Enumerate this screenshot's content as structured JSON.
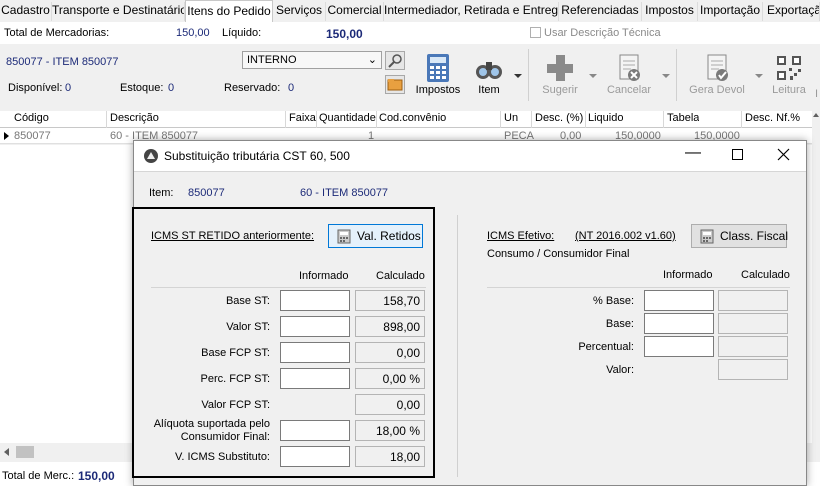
{
  "tabs": [
    {
      "label": "Cadastro"
    },
    {
      "label": "Transporte e Destinatário"
    },
    {
      "label": "Itens do Pedido"
    },
    {
      "label": "Serviços"
    },
    {
      "label": "Comercial"
    },
    {
      "label": "Intermediador, Retirada e Entrega"
    },
    {
      "label": "Referenciadas"
    },
    {
      "label": "Impostos"
    },
    {
      "label": "Importação"
    },
    {
      "label": "Exportação"
    }
  ],
  "totals": {
    "total_mercadorias_label": "Total de Mercadorias:",
    "total_mercadorias_value": "150,00",
    "liquido_label": "Líquido:",
    "liquido_value": "150,00",
    "usar_descricao_label": "Usar Descrição Técnica"
  },
  "item": {
    "name": "850077 - ITEM 850077",
    "disponivel_label": "Disponível:",
    "disponivel_value": "0",
    "estoque_label": "Estoque:",
    "estoque_value": "0",
    "reservado_label": "Reservado:",
    "reservado_value": "0",
    "combo_value": "INTERNO"
  },
  "toolbar": {
    "impostos": "Impostos",
    "item": "Item",
    "sugerir": "Sugerir",
    "cancelar": "Cancelar",
    "gera_devol": "Gera Devol",
    "leitura": "Leitura",
    "more": "I"
  },
  "grid": {
    "headers": [
      "Código",
      "Descrição",
      "Faixa",
      "Quantidade",
      "Cod.convênio",
      "Un",
      "Desc. (%)",
      "Liquido",
      "Tabela",
      "Desc. Nf.%"
    ],
    "row": {
      "codigo": "850077",
      "descricao": "60 - ITEM 850077",
      "quantidade": "1",
      "un": "PECA",
      "desc": "0,00",
      "liquido": "150,0000",
      "tabela": "150,0000"
    }
  },
  "footer": {
    "total_label": "Total de Merc.:",
    "total_value": "150,00"
  },
  "dialog": {
    "title": "Substituição tributária CST 60, 500",
    "item_label": "Item:",
    "item_code": "850077",
    "item_desc": "60 - ITEM 850077",
    "left": {
      "section_label": "ICMS ST RETIDO anteriormente:",
      "button_label": "Val. Retidos",
      "col_informado": "Informado",
      "col_calculado": "Calculado",
      "rows": [
        {
          "label": "Base ST:",
          "informado": "",
          "calculado": "158,70"
        },
        {
          "label": "Valor ST:",
          "informado": "",
          "calculado": "898,00"
        },
        {
          "label": "Base FCP ST:",
          "informado": "",
          "calculado": "0,00"
        },
        {
          "label": "Perc. FCP ST:",
          "informado": "",
          "calculado": "0,00 %"
        },
        {
          "label": "Valor FCP ST:",
          "calculado": "0,00"
        },
        {
          "label_line1": "Alíquota suportada pelo",
          "label_line2": "Consumidor Final:",
          "informado": "",
          "calculado": "18,00 %"
        },
        {
          "label": "V. ICMS Substituto:",
          "informado": "",
          "calculado": "18,00"
        }
      ]
    },
    "right": {
      "section_label": "ICMS Efetivo:",
      "section_note": "(NT 2016.002 v1.60)",
      "subtitle": "Consumo / Consumidor Final",
      "button_label": "Class. Fiscal",
      "col_informado": "Informado",
      "col_calculado": "Calculado",
      "rows": [
        {
          "label": "% Base:"
        },
        {
          "label": "Base:"
        },
        {
          "label": "Percentual:"
        },
        {
          "label": "Valor:"
        }
      ]
    },
    "highlight_color": "#000000"
  }
}
